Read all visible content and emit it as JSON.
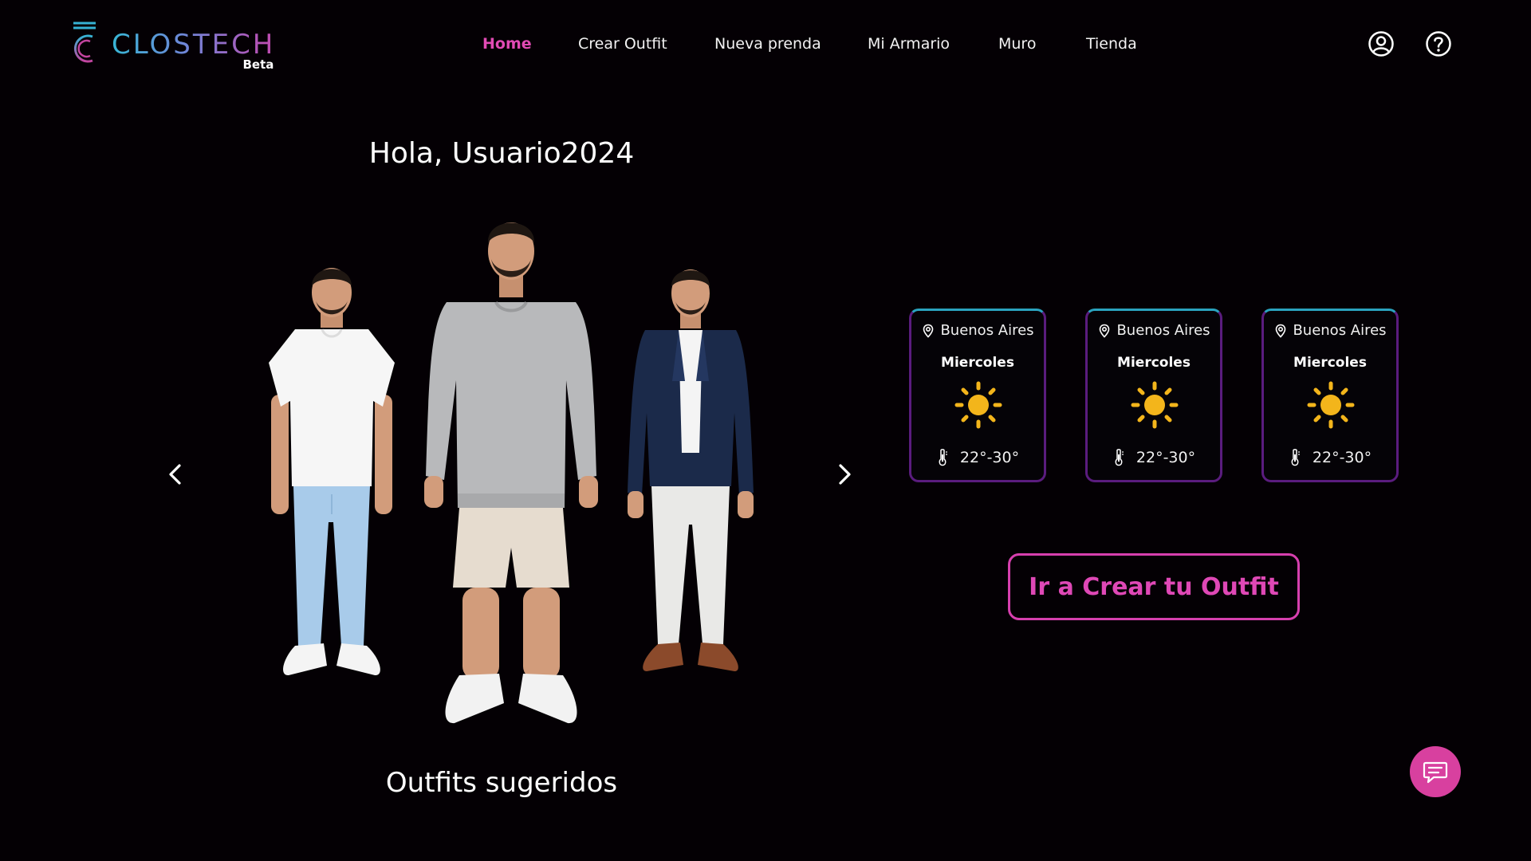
{
  "brand": {
    "name": "CLOSTECH",
    "badge": "Beta"
  },
  "nav": {
    "items": [
      {
        "label": "Home",
        "active": true
      },
      {
        "label": "Crear Outfit",
        "active": false
      },
      {
        "label": "Nueva prenda",
        "active": false
      },
      {
        "label": "Mi Armario",
        "active": false
      },
      {
        "label": "Muro",
        "active": false
      },
      {
        "label": "Tienda",
        "active": false
      }
    ]
  },
  "header_icons": [
    "user-circle-icon",
    "help-circle-icon"
  ],
  "greeting": "Hola, Usuario2024",
  "carousel": {
    "caption": "Outfits sugeridos",
    "outfits": [
      {
        "top": "white t-shirt",
        "bottom": "light blue jeans",
        "shoes": "white sneakers"
      },
      {
        "top": "grey sweatshirt",
        "bottom": "beige shorts",
        "shoes": "white sneakers"
      },
      {
        "top": "navy blazer, white shirt",
        "bottom": "white trousers",
        "shoes": "brown shoes"
      }
    ]
  },
  "weather": [
    {
      "location": "Buenos Aires",
      "day": "Miercoles",
      "condition_icon": "sun-icon",
      "temp": "22°-30°"
    },
    {
      "location": "Buenos Aires",
      "day": "Miercoles",
      "condition_icon": "sun-icon",
      "temp": "22°-30°"
    },
    {
      "location": "Buenos Aires",
      "day": "Miercoles",
      "condition_icon": "sun-icon",
      "temp": "22°-30°"
    }
  ],
  "cta": {
    "label": "Ir a Crear tu Outfit"
  },
  "chat_icon": "chat-bubble-icon",
  "colors": {
    "background": "#040004",
    "accent_pink": "#e14bb4",
    "accent_cyan": "#2aa3bf",
    "card_border": "#5a1c7e",
    "sun": "#f3b51b"
  }
}
